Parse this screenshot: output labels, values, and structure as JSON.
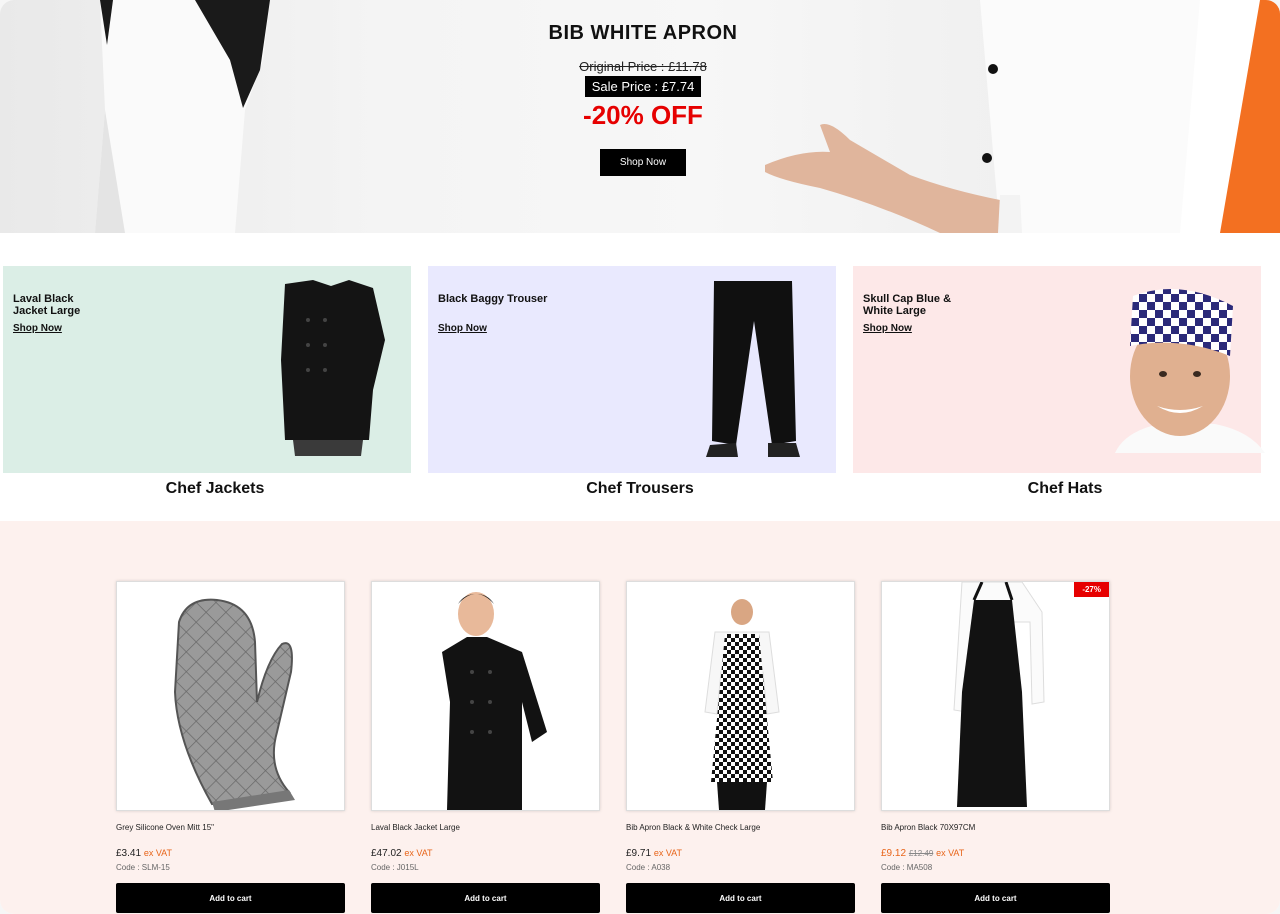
{
  "hero": {
    "title": "BIB WHITE APRON",
    "original_price": "Original Price : £11.78",
    "sale_price": "Sale Price : £7.74",
    "discount": "-20% OFF",
    "cta": "Shop Now"
  },
  "categories": [
    {
      "name": "Laval Black Jacket Large",
      "cta": "Shop Now",
      "label": "Chef Jackets",
      "bg": "#dbeee6"
    },
    {
      "name": "Black Baggy Trouser",
      "cta": "Shop Now",
      "label": "Chef Trousers",
      "bg": "#e9e9fe"
    },
    {
      "name": "Skull Cap Blue & White Large",
      "cta": "Shop Now",
      "label": "Chef Hats",
      "bg": "#fde8e8"
    }
  ],
  "products": [
    {
      "name": "Grey Silicone Oven Mitt 15\"",
      "price": "£3.41",
      "vat": "ex VAT",
      "old_price": "",
      "code": "Code : SLM-15",
      "cta": "Add to cart",
      "badge": ""
    },
    {
      "name": "Laval Black Jacket Large",
      "price": "£47.02",
      "vat": "ex VAT",
      "old_price": "",
      "code": "Code : J015L",
      "cta": "Add to cart",
      "badge": ""
    },
    {
      "name": "Bib Apron Black & White Check Large",
      "price": "£9.71",
      "vat": "ex VAT",
      "old_price": "",
      "code": "Code : A038",
      "cta": "Add to cart",
      "badge": ""
    },
    {
      "name": "Bib Apron Black 70X97CM",
      "price": "£9.12",
      "vat": "ex VAT",
      "old_price": "£12.49",
      "code": "Code : MA508",
      "cta": "Add to cart",
      "badge": "-27%"
    }
  ],
  "colors": {
    "accent": "#e60000",
    "vat": "#e8651a",
    "products_bg": "#fdf1ee"
  }
}
